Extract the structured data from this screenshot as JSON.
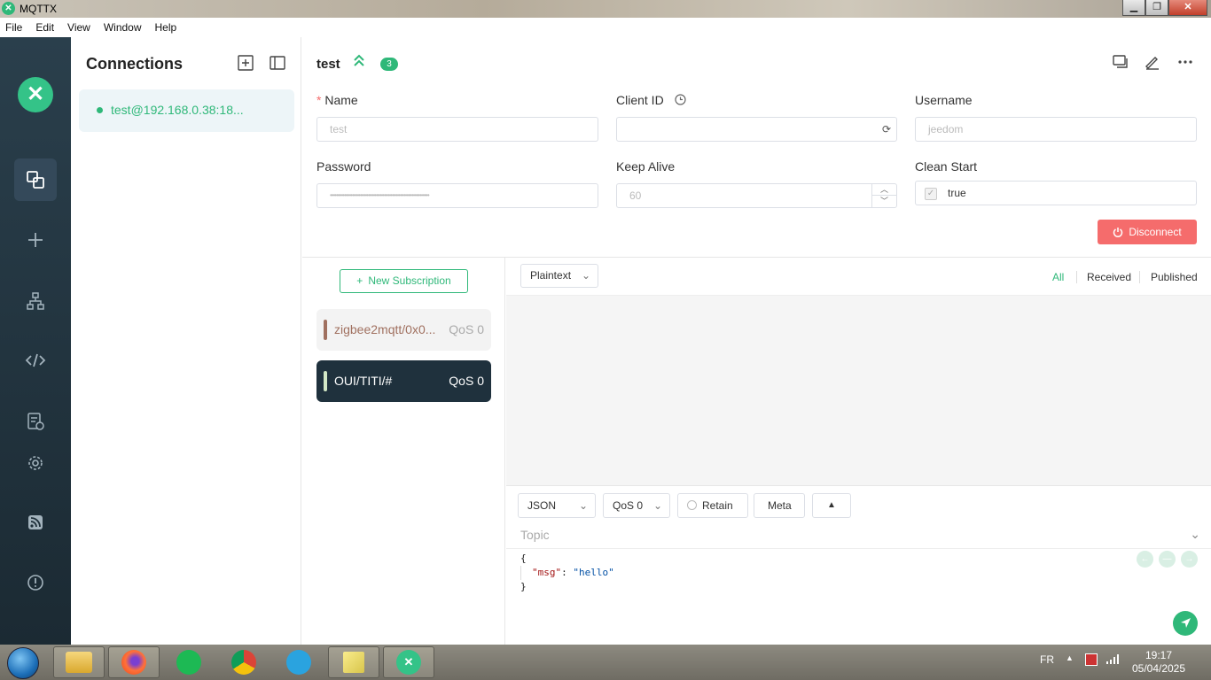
{
  "window": {
    "title": "MQTTX",
    "minimize": "▁",
    "maximize": "❐",
    "close": "✕"
  },
  "menu": [
    "File",
    "Edit",
    "View",
    "Window",
    "Help"
  ],
  "sidebar": {
    "logo": "✕"
  },
  "connections": {
    "title": "Connections",
    "items": [
      {
        "name": "test@192.168.0.38:18...",
        "status": "connected"
      }
    ]
  },
  "header": {
    "name": "test",
    "badge": "3"
  },
  "form": {
    "name_label": "Name",
    "name_required_mark": "*",
    "name_value": "test",
    "client_id_label": "Client ID",
    "client_id_value": "",
    "username_label": "Username",
    "username_value": "jeedom",
    "password_label": "Password",
    "password_value": "••••••••••••••••••••••••••••••••••••••••••••••••••••••••••••••",
    "keepalive_label": "Keep Alive",
    "keepalive_value": "60",
    "clean_start_label": "Clean Start",
    "clean_start_value": "true",
    "disconnect_label": "Disconnect"
  },
  "subscriptions": {
    "new_label": "New Subscription",
    "items": [
      {
        "topic": "zigbee2mqtt/0x0...",
        "qos": "QoS 0",
        "color": "#a0705f"
      },
      {
        "topic": "OUI/TITI/#",
        "qos": "QoS 0",
        "color": "#d3e8c6"
      }
    ]
  },
  "messages": {
    "format": "Plaintext",
    "filters": [
      "All",
      "Received",
      "Published"
    ],
    "active_filter": "All"
  },
  "publish": {
    "format": "JSON",
    "qos": "QoS 0",
    "retain_label": "Retain",
    "meta_label": "Meta",
    "topic_placeholder": "Topic",
    "payload_open": "{",
    "payload_key": "\"msg\"",
    "payload_colon": ": ",
    "payload_value": "\"hello\"",
    "payload_close": "}"
  },
  "taskbar": {
    "lang": "FR",
    "time": "19:17",
    "date": "05/04/2025"
  },
  "colors": {
    "accent": "#2fb879",
    "danger": "#f56c6c",
    "nav_bg": "#23343f"
  }
}
